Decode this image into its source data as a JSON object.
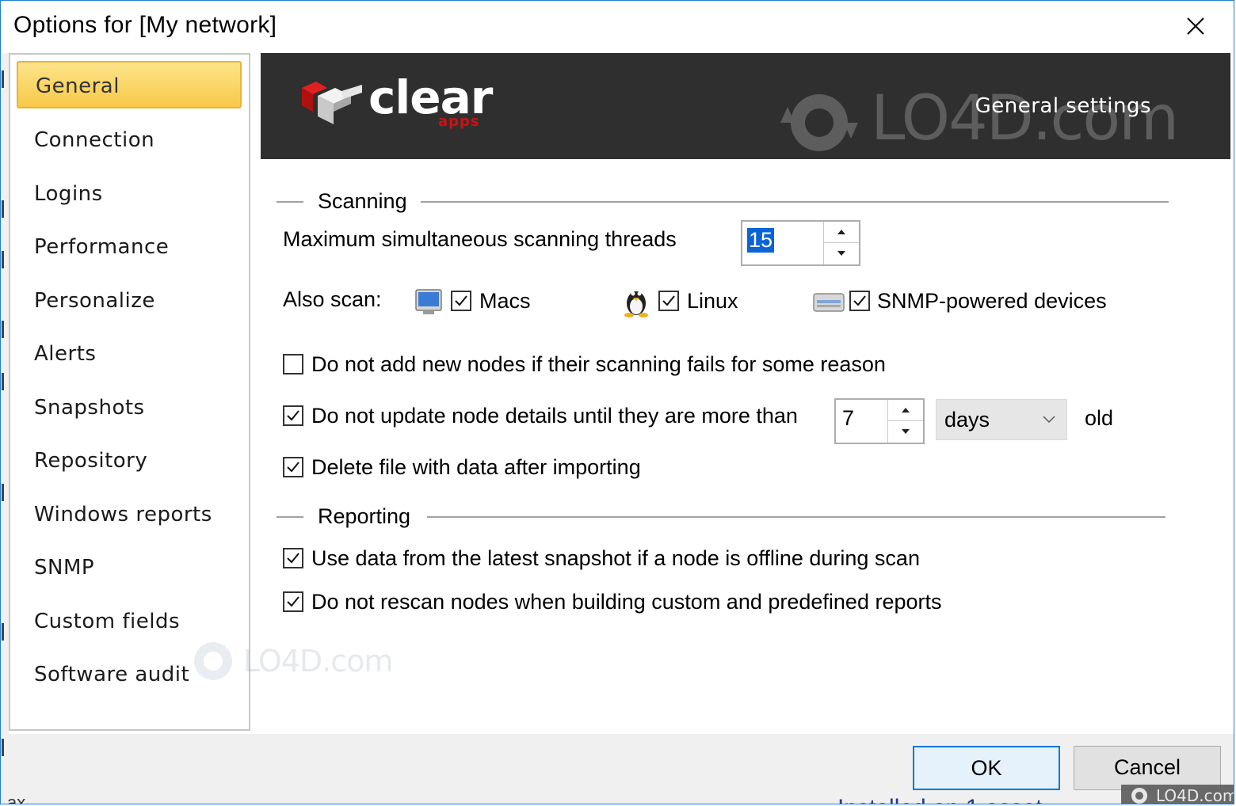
{
  "window": {
    "title": "Options for [My network]"
  },
  "sidebar": {
    "items": [
      {
        "label": "General",
        "active": true
      },
      {
        "label": "Connection"
      },
      {
        "label": "Logins"
      },
      {
        "label": "Performance"
      },
      {
        "label": "Personalize"
      },
      {
        "label": "Alerts"
      },
      {
        "label": "Snapshots"
      },
      {
        "label": "Repository"
      },
      {
        "label": "Windows reports"
      },
      {
        "label": "SNMP"
      },
      {
        "label": "Custom fields"
      },
      {
        "label": "Software audit"
      }
    ]
  },
  "banner": {
    "logo_text": "clear",
    "logo_sub": "apps",
    "title": "General settings",
    "watermark": "LO4D.com"
  },
  "scanning": {
    "section_label": "Scanning",
    "max_threads_label": "Maximum simultaneous scanning threads",
    "max_threads_value": "15",
    "also_scan_label": "Also scan:",
    "macs": {
      "label": "Macs",
      "checked": true
    },
    "linux": {
      "label": "Linux",
      "checked": true
    },
    "snmp": {
      "label": "SNMP-powered devices",
      "checked": true
    },
    "no_add_failed": {
      "label": "Do not add new nodes if their scanning fails for some reason",
      "checked": false
    },
    "no_update": {
      "label": "Do not update node details until they are more than",
      "checked": true
    },
    "days_value": "7",
    "days_unit": "days",
    "old_label": "old",
    "delete_file": {
      "label": "Delete file with data after importing",
      "checked": true
    }
  },
  "reporting": {
    "section_label": "Reporting",
    "use_latest": {
      "label": "Use data from the latest snapshot if a node is offline during scan",
      "checked": true
    },
    "no_rescan": {
      "label": "Do not rescan nodes when building custom and predefined reports",
      "checked": true
    }
  },
  "buttons": {
    "ok": "OK",
    "cancel": "Cancel"
  },
  "watermarks": {
    "center": "LO4D.com",
    "corner": "LO4D.com"
  },
  "background_peek": {
    "right": "Installed on 1 asset",
    "left": "ax"
  },
  "colors": {
    "accent": "#0078d7",
    "nav_active": "#fcd868",
    "banner_bg": "#2f2f2f",
    "selection": "#0a64d6"
  }
}
